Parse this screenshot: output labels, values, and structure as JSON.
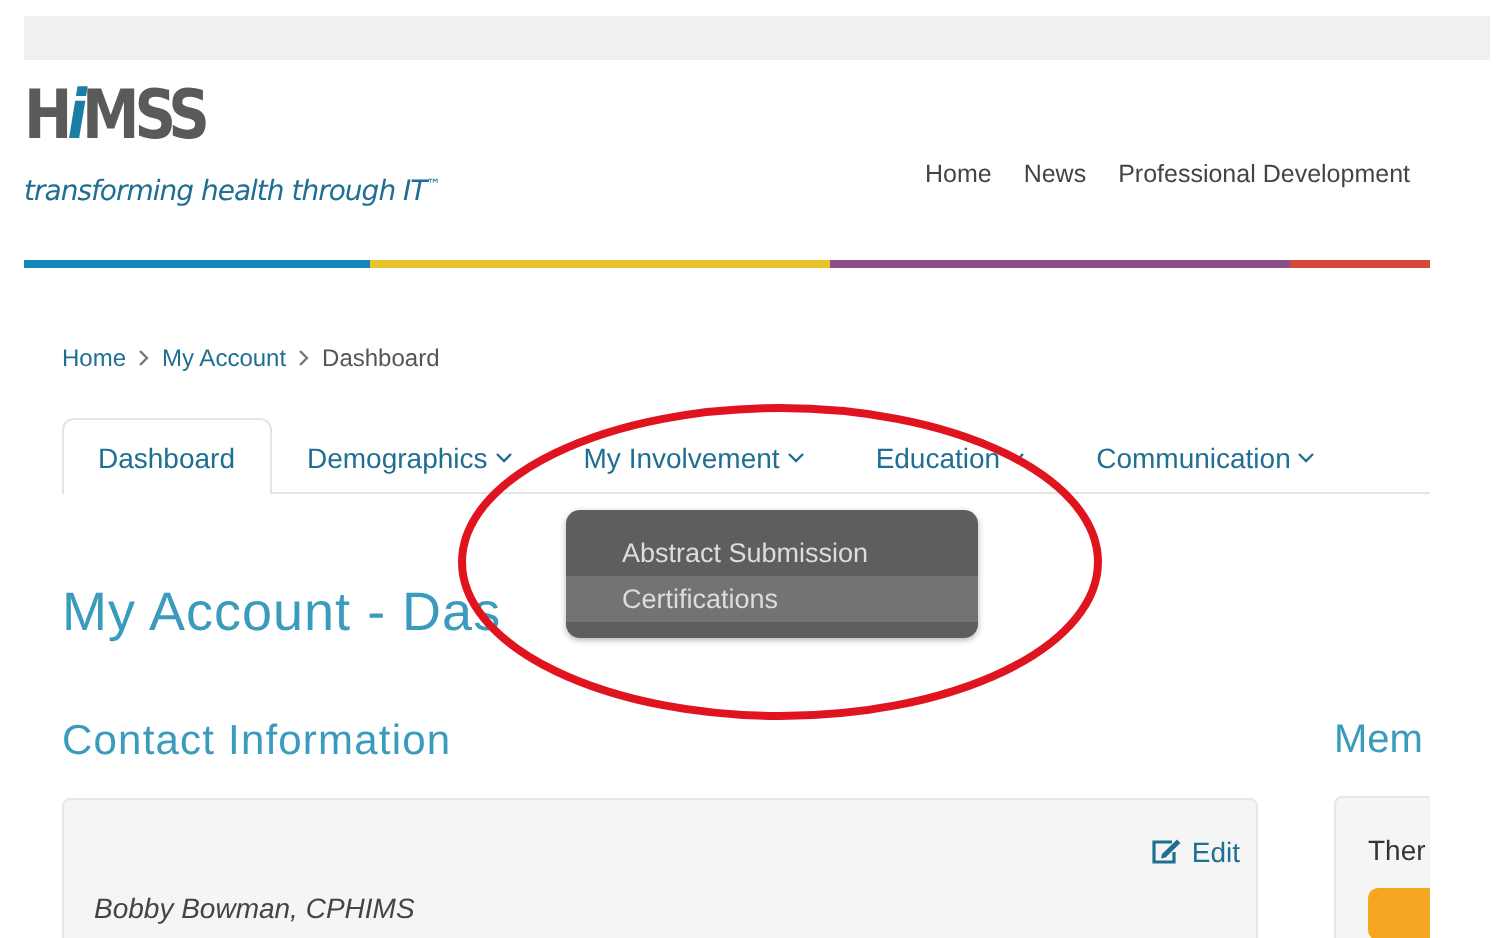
{
  "logo": {
    "wordmark": [
      {
        "text": "H",
        "accent": false
      },
      {
        "text": "i",
        "accent": true
      },
      {
        "text": "MSS",
        "accent": false
      }
    ],
    "tagline": "transforming health through IT$^{™}$"
  },
  "top_nav": [
    "Home",
    "News",
    "Professional Development"
  ],
  "breadcrumb": [
    {
      "label": "Home",
      "link": true
    },
    {
      "label": "My Account",
      "link": true
    },
    {
      "label": "Dashboard",
      "link": false
    }
  ],
  "tabs": [
    {
      "label": "Dashboard",
      "selected": true,
      "has_menu": false
    },
    {
      "label": "Demographics",
      "selected": false,
      "has_menu": true
    },
    {
      "label": "My Involvement",
      "selected": false,
      "has_menu": true
    },
    {
      "label": "Education",
      "selected": false,
      "has_menu": true
    },
    {
      "label": "Communication",
      "selected": false,
      "has_menu": true
    }
  ],
  "dropdown": {
    "items": [
      {
        "label": "Abstract Submission",
        "selected": false
      },
      {
        "label": "Certifications",
        "selected": true
      }
    ]
  },
  "page_title": "My Account - Das",
  "contact": {
    "heading": "Contact Information",
    "edit": "Edit",
    "name": "Bobby Bowman, CPHIMS"
  },
  "membership": {
    "heading": "Mem",
    "text": "Ther"
  }
}
